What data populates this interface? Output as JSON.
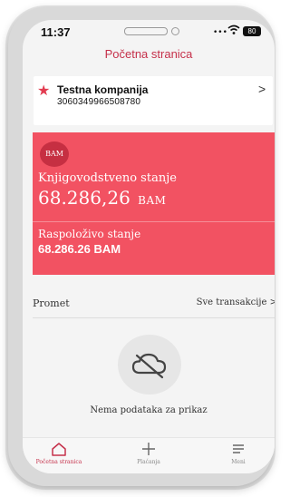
{
  "status_bar": {
    "time": "11:37",
    "signal": "•••",
    "battery": "80"
  },
  "header": {
    "title": "Početna stranica"
  },
  "company": {
    "name": "Testna kompanija",
    "id": "3060349966508780",
    "chevron": ">"
  },
  "balance_card": {
    "currency_badge": "BAM",
    "book_label": "Knjigovodstveno stanje",
    "book_amount": "68.286,26",
    "book_currency": "BAM",
    "available_label": "Raspoloživo stanje",
    "available_amount": "68.286.26 BAM",
    "color": "#f25262"
  },
  "transactions": {
    "title": "Promet",
    "link": "Sve transakcije >",
    "empty_text": "Nema podataka za prikaz",
    "empty_icon": "cloud-off-icon"
  },
  "tabbar": {
    "items": [
      {
        "label": "Početna stranica",
        "icon": "home-icon",
        "active": true
      },
      {
        "label": "Plaćanja",
        "icon": "plus-icon",
        "active": false
      },
      {
        "label": "Meni",
        "icon": "menu-icon",
        "active": false
      }
    ]
  },
  "colors": {
    "accent": "#c5304a",
    "card": "#f25262"
  }
}
